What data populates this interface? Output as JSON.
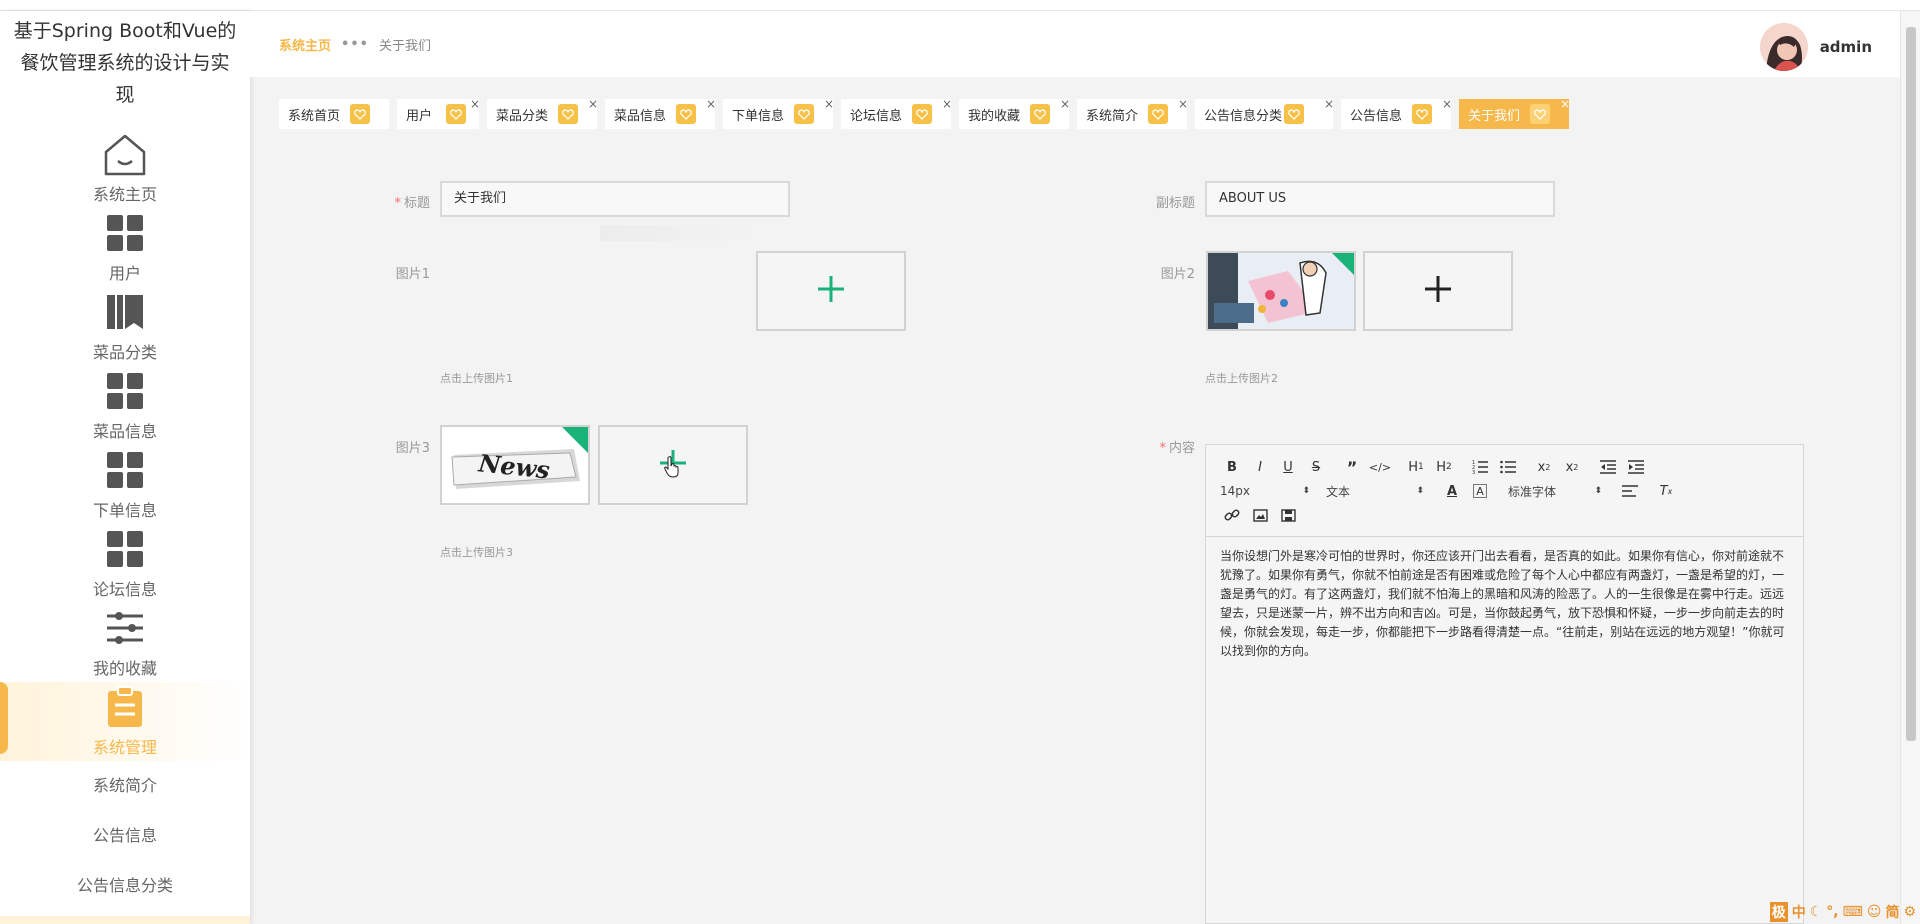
{
  "app": {
    "title": "基于Spring Boot和Vue的餐饮管理系统的设计与实现"
  },
  "sidebar": {
    "items": [
      {
        "label": "系统主页",
        "icon": "home-icon"
      },
      {
        "label": "用户",
        "icon": "grid-icon"
      },
      {
        "label": "菜品分类",
        "icon": "bookshelf-icon"
      },
      {
        "label": "菜品信息",
        "icon": "grid-icon"
      },
      {
        "label": "下单信息",
        "icon": "grid-icon"
      },
      {
        "label": "论坛信息",
        "icon": "grid-icon"
      },
      {
        "label": "我的收藏",
        "icon": "sliders-icon"
      },
      {
        "label": "系统管理",
        "icon": "clipboard-icon",
        "active": true
      }
    ],
    "subitems": [
      {
        "label": "系统简介"
      },
      {
        "label": "公告信息"
      },
      {
        "label": "公告信息分类"
      }
    ]
  },
  "header": {
    "breadcrumb": {
      "home": "系统主页",
      "separator": "•••",
      "current": "关于我们"
    },
    "user": {
      "name": "admin"
    }
  },
  "tabs": [
    {
      "label": "系统首页",
      "closable": false
    },
    {
      "label": "用户",
      "closable": true
    },
    {
      "label": "菜品分类",
      "closable": true
    },
    {
      "label": "菜品信息",
      "closable": true
    },
    {
      "label": "下单信息",
      "closable": true
    },
    {
      "label": "论坛信息",
      "closable": true
    },
    {
      "label": "我的收藏",
      "closable": true
    },
    {
      "label": "系统简介",
      "closable": true
    },
    {
      "label": "公告信息分类",
      "closable": true
    },
    {
      "label": "公告信息",
      "closable": true
    },
    {
      "label": "关于我们",
      "closable": true,
      "active": true
    }
  ],
  "form": {
    "title": {
      "label": "标题",
      "value": "关于我们",
      "required": true
    },
    "subtitle": {
      "label": "副标题",
      "value": "ABOUT US"
    },
    "pic1": {
      "label": "图片1",
      "tip": "点击上传图片1"
    },
    "pic2": {
      "label": "图片2",
      "tip": "点击上传图片2"
    },
    "pic3": {
      "label": "图片3",
      "tip": "点击上传图片3"
    },
    "content": {
      "label": "内容",
      "required": true
    }
  },
  "editor": {
    "font_size": "14px",
    "block_type": "文本",
    "font_family": "标准字体",
    "text": "当你设想门外是寒冷可怕的世界时，你还应该开门出去看看，是否真的如此。如果你有信心，你对前途就不犹豫了。如果你有勇气，你就不怕前途是否有困难或危险了每个人心中都应有两盏灯，一盏是希望的灯，一盏是勇气的灯。有了这两盏灯，我们就不怕海上的黑暗和风涛的险恶了。人的一生很像是在雾中行走。远远望去，只是迷蒙一片，辨不出方向和吉凶。可是，当你鼓起勇气，放下恐惧和怀疑，一步一步向前走去的时候，你就会发现，每走一步，你都能把下一步路看得清楚一点。“往前走，别站在远远的地方观望！”你就可以找到你的方向。"
  },
  "ime": {
    "chars": [
      "极",
      "中",
      "简"
    ]
  },
  "colors": {
    "accent": "#f7b84b",
    "upload_plus": "#19b37a",
    "required": "#f56c6c"
  }
}
